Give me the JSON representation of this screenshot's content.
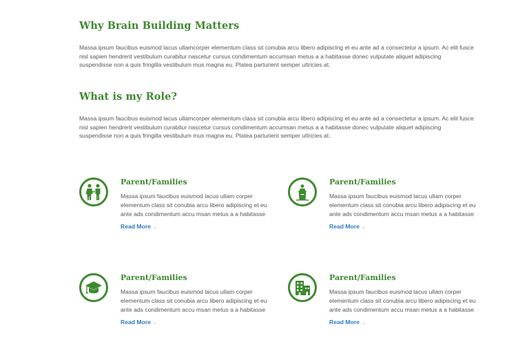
{
  "sections": [
    {
      "title": "Why Brain Building Matters",
      "body": "Massa ipsum faucibus euismod lacus ullamcorper elementum class sit conubia arcu libero adipiscing et eu ante ad a consectetur a ipsum. Ac elit fusce nisl sapien hendrerit vestibulum curabitur nascetur cursus condimentum accumsan metus a a habitasse donec vulputate aliquet adipiscing suspendisse non a quis fringilla vestibulum mus magna eu. Platea parturient semper ultricies at."
    },
    {
      "title": "What is my Role?",
      "body": "Massa ipsum faucibus euismod lacus ullamcorper elementum class sit conubia arcu libero adipiscing et eu ante ad a consectetur a ipsum. Ac elit fusce nisl sapien hendrerit vestibulum curabitur nascetur cursus condimentum accumsan metus a a habitasse donec vulputate aliquet adipiscing suspendisse non a quis fringilla vestibulum mus magna eu. Platea parturient semper ultricies at."
    }
  ],
  "cards": [
    {
      "icon": "family-icon",
      "title": "Parent/Families",
      "body": "Massa ipsum faucibus euismod lacus ullam corper elementum class sit conubia arcu libero adipiscing et eu ante ads condimentum accu msan metus a a habitasse",
      "link": "Read More"
    },
    {
      "icon": "podium-icon",
      "title": "Parent/Families",
      "body": "Massa ipsum faucibus euismod lacus ullam corper elementum class sit conubia arcu libero adipiscing et eu ante ads condimentum accu msan metus a a habitasse",
      "link": "Read More"
    },
    {
      "icon": "graduation-cap-icon",
      "title": "Parent/Families",
      "body": "Massa ipsum faucibus euismod lacus ullam corper elementum class sit conubia arcu libero adipiscing et eu ante ads condimentum accu msan metus a a habitasse",
      "link": "Read More"
    },
    {
      "icon": "buildings-icon",
      "title": "Parent/Families",
      "body": "Massa ipsum faucibus euismod lacus ullam corper elementum class sit conubia arcu libero adipiscing et eu ante ads condimentum accu msan metus a a habitasse",
      "link": "Read More"
    }
  ],
  "colors": {
    "accent_green": "#3e8a2f",
    "link_blue": "#2a7bc4",
    "body_text": "#555555"
  }
}
